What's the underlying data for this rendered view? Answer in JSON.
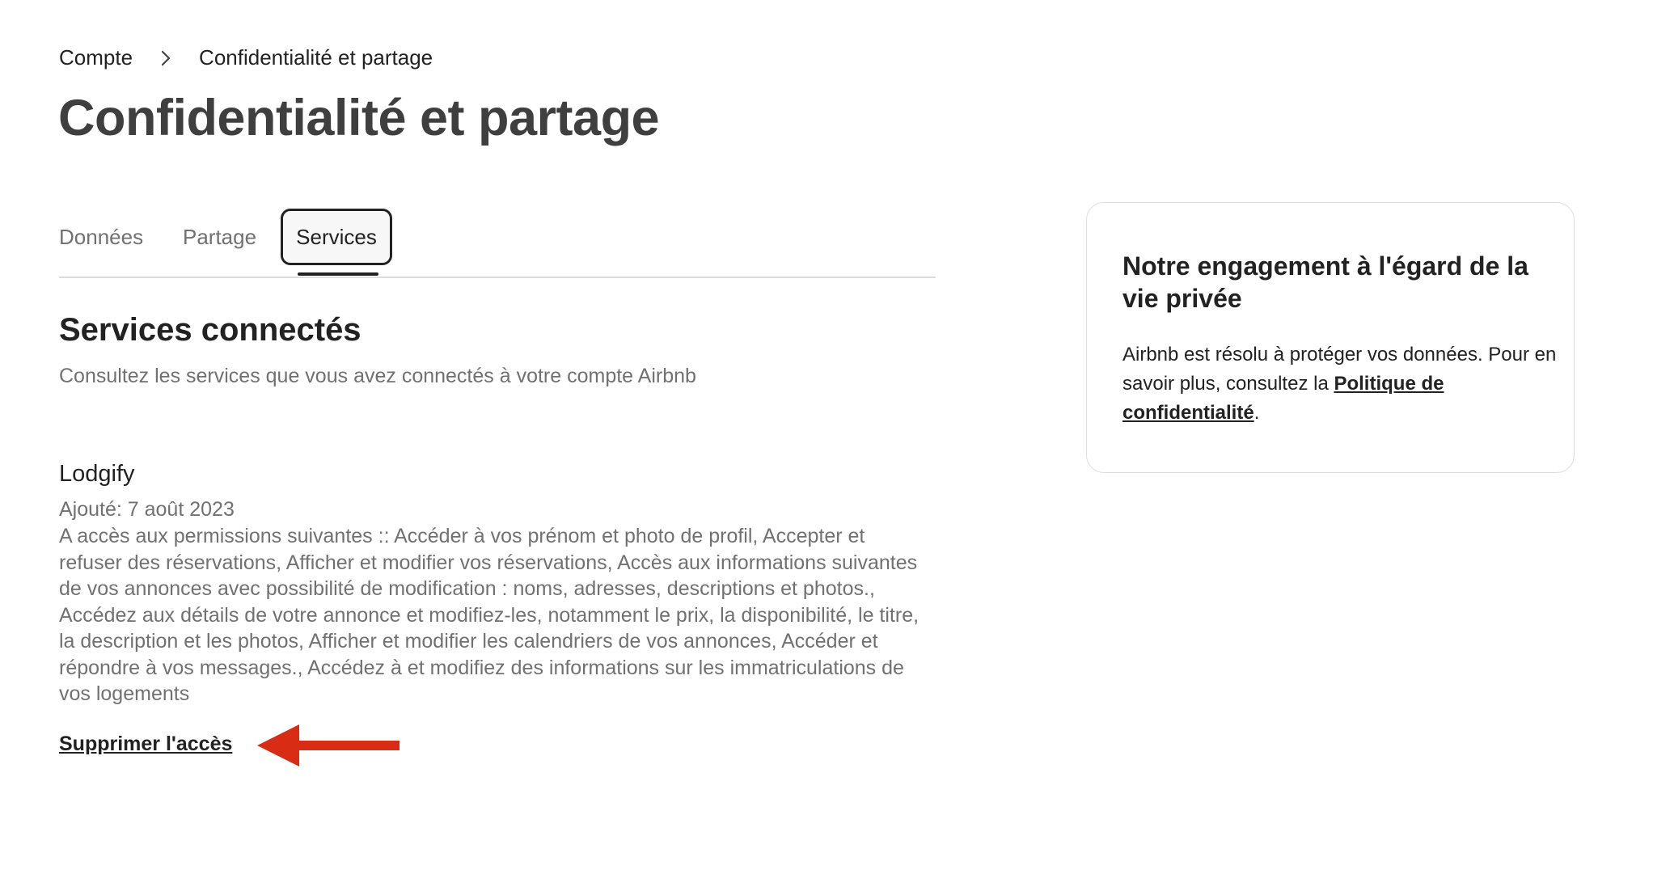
{
  "breadcrumb": {
    "account": "Compte",
    "current": "Confidentialité et partage"
  },
  "page_title": "Confidentialité et partage",
  "tabs": [
    {
      "label": "Données"
    },
    {
      "label": "Partage"
    },
    {
      "label": "Services",
      "active": true
    }
  ],
  "section": {
    "title": "Services connectés",
    "subtitle": "Consultez les services que vous avez connectés à votre compte Airbnb"
  },
  "service": {
    "name": "Lodgify",
    "added": "Ajouté: 7 août 2023",
    "permissions": "A accès aux permissions suivantes :: Accéder à vos prénom et photo de profil, Accepter et refuser des réservations, Afficher et modifier vos réservations, Accès aux informations suivantes de vos annonces avec possibilité de modification : noms, adresses, descriptions et photos., Accédez aux détails de votre annonce et modifiez-les, notamment le prix, la disponibilité, le titre, la description et les photos, Afficher et modifier les calendriers de vos annonces, Accéder et répondre à vos messages., Accédez à et modifiez des informations sur les immatriculations de vos logements",
    "remove_label": "Supprimer l'accès"
  },
  "privacy_card": {
    "title": "Notre engagement à l'égard de la vie privée",
    "body_before": "Airbnb est résolu à protéger vos données. Pour en savoir plus, consultez la ",
    "link": "Politique de confidentialité",
    "body_after": "."
  },
  "colors": {
    "text": "#222222",
    "muted": "#717171",
    "divider": "#dddddd",
    "arrow": "#d92c14"
  },
  "icons": {
    "breadcrumb_separator": "chevron-right-icon",
    "annotation": "red-arrow-left-icon"
  }
}
